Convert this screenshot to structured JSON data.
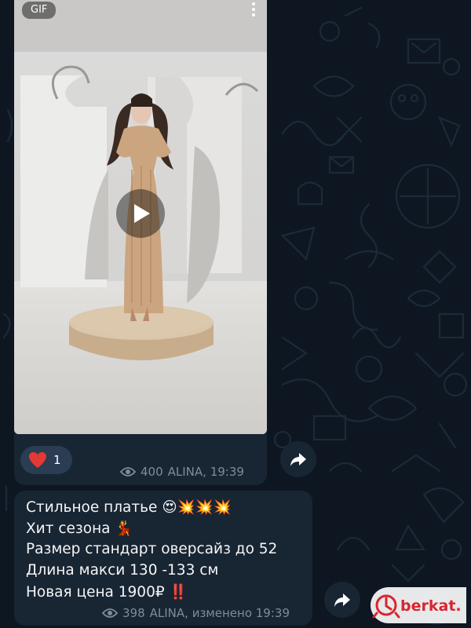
{
  "colors": {
    "background": "#0e1621",
    "bubble": "#182533",
    "meta_text": "#7e8c9c",
    "reaction_pill": "#2b3d52",
    "heart": "#e53935",
    "watermark_red": "#d7262f"
  },
  "media_message": {
    "badge": "GIF",
    "reaction": {
      "icon": "heart-icon",
      "count": "1"
    },
    "views": "400",
    "footer": "ALINA, 19:39"
  },
  "caption_message": {
    "lines": [
      "Стильное платье 😍💥💥💥",
      "Хит сезона 💃",
      "Размер стандарт оверсайз до 52",
      "Длина макси 130 -133 см",
      "Новая цена 1900₽ ‼️"
    ],
    "views": "398",
    "footer": "ALINA, изменено 19:39"
  },
  "watermark": {
    "text": "berkat."
  }
}
